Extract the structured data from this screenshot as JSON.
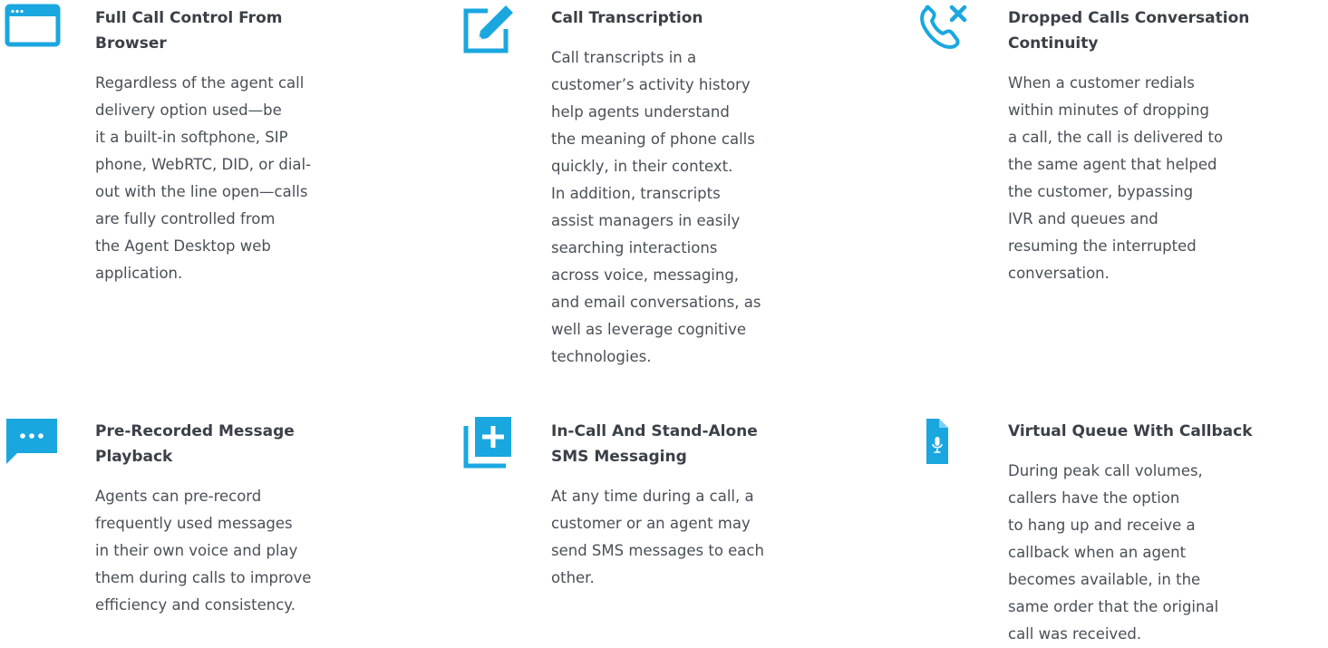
{
  "colors": {
    "accent": "#1aa7e0",
    "title": "#3b4048",
    "text": "#4a4f57"
  },
  "features": [
    {
      "icon": "browser-window-icon",
      "title": "Full Call Control From\nBrowser",
      "description": "Regardless of the agent call\ndelivery option used—be\nit a built-in softphone, SIP\nphone, WebRTC, DID, or dial-\nout with the line open—calls\nare fully controlled from\nthe Agent Desktop web\napplication."
    },
    {
      "icon": "edit-pencil-icon",
      "title": "Call Transcription",
      "description": "Call transcripts in a\ncustomer’s activity history\nhelp agents understand\nthe meaning of phone calls\nquickly, in their context.\nIn addition, transcripts\nassist managers in easily\nsearching interactions\nacross voice, messaging,\nand email conversations, as\nwell as leverage cognitive\ntechnologies."
    },
    {
      "icon": "dropped-call-icon",
      "title": "Dropped Calls Conversation\nContinuity",
      "description": "When a customer redials\nwithin minutes of dropping\na call, the call is delivered to\nthe same agent that helped\nthe customer, bypassing\nIVR and queues and\nresuming the interrupted\nconversation."
    },
    {
      "icon": "chat-bubble-icon",
      "title": "Pre-Recorded Message\nPlayback",
      "description": "Agents can pre-record\nfrequently used messages\nin their own voice and play\nthem during calls to improve\nefficiency and consistency."
    },
    {
      "icon": "add-message-icon",
      "title": "In-Call And Stand-Alone\nSMS Messaging",
      "description": "At any time during a call, a\ncustomer or an agent may\nsend SMS messages to each\nother."
    },
    {
      "icon": "audio-file-icon",
      "title": "Virtual Queue With Callback",
      "description": "During peak call volumes,\ncallers have the option\nto hang up and receive a\ncallback when an agent\nbecomes available, in the\nsame order that the original\ncall was received."
    }
  ]
}
